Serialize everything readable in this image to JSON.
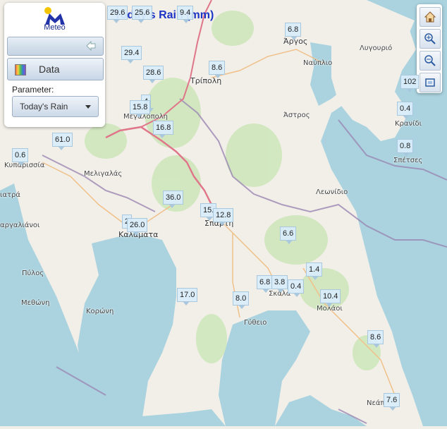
{
  "title": "Today's Rain (mm)",
  "logo": {
    "text": "Meteo"
  },
  "panel": {
    "data_button": "Data",
    "parameter_label": "Parameter:",
    "parameter_value": "Today's Rain"
  },
  "places": [
    {
      "key": "argos",
      "label": "Άργος"
    },
    {
      "key": "nafplio",
      "label": "Ναύπλιο"
    },
    {
      "key": "lygourio",
      "label": "Λυγουριό"
    },
    {
      "key": "tripoli",
      "label": "Τρίπολη"
    },
    {
      "key": "megalopoli",
      "label": "Μεγαλόπολη"
    },
    {
      "key": "astros",
      "label": "Άστρος"
    },
    {
      "key": "kranidi",
      "label": "Κρανίδι"
    },
    {
      "key": "spetses",
      "label": "Σπέτσες"
    },
    {
      "key": "kyparissia",
      "label": "Κυπαρισσία"
    },
    {
      "key": "meligalas",
      "label": "Μελιγαλάς"
    },
    {
      "key": "gargalianoi",
      "label": "αργαλιάνοι"
    },
    {
      "key": "filiatra",
      "label": "ιατρά"
    },
    {
      "key": "kalamata",
      "label": "Καλαμάτα"
    },
    {
      "key": "sparti",
      "label": "Σπάρτη"
    },
    {
      "key": "leonidio",
      "label": "Λεωνίδιο"
    },
    {
      "key": "pylos",
      "label": "Πύλος"
    },
    {
      "key": "methoni",
      "label": "Μεθώνη"
    },
    {
      "key": "koroni",
      "label": "Κορώνη"
    },
    {
      "key": "skala",
      "label": "Σκάλα"
    },
    {
      "key": "molaoi",
      "label": "Μολάοι"
    },
    {
      "key": "gytheio",
      "label": "Γύθειο"
    },
    {
      "key": "neapoli",
      "label": "Νεάπ"
    }
  ],
  "stations": [
    {
      "value": "29.6"
    },
    {
      "value": "25.6"
    },
    {
      "value": "9.4"
    },
    {
      "value": "6.8"
    },
    {
      "value": "29.4"
    },
    {
      "value": "28.6"
    },
    {
      "value": "8.6"
    },
    {
      "value": "102"
    },
    {
      "value": "4"
    },
    {
      "value": "15.8"
    },
    {
      "value": "0.4"
    },
    {
      "value": "16.8"
    },
    {
      "value": "61.0"
    },
    {
      "value": "0.8"
    },
    {
      "value": "0.6"
    },
    {
      "value": "36.0"
    },
    {
      "value": "15."
    },
    {
      "value": "12.8"
    },
    {
      "value": "2"
    },
    {
      "value": "26.0"
    },
    {
      "value": "6.6"
    },
    {
      "value": "1.4"
    },
    {
      "value": "6.8"
    },
    {
      "value": "3.8"
    },
    {
      "value": "0.4"
    },
    {
      "value": "17.0"
    },
    {
      "value": "8.0"
    },
    {
      "value": "10.4"
    },
    {
      "value": "8.6"
    },
    {
      "value": "7.6"
    }
  ],
  "colors": {
    "sea": "#aad3df",
    "land": "#f2efe9",
    "forest": "#cde6b9",
    "title": "#1c34c6",
    "marker": "#d8ecfa"
  }
}
